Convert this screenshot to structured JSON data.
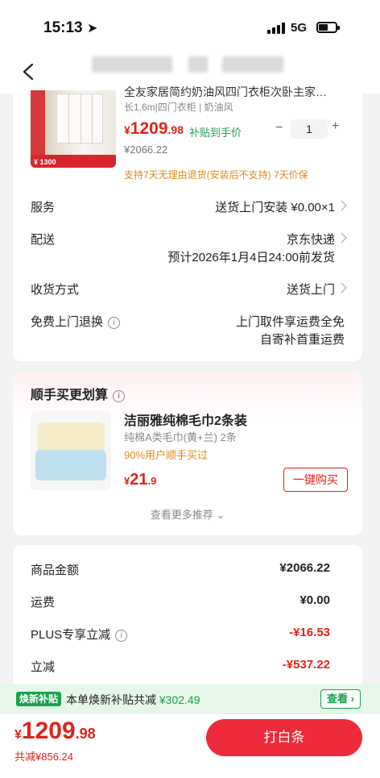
{
  "status_bar": {
    "time": "15:13",
    "network": "5G"
  },
  "product": {
    "title": "全友家居简约奶油风四门衣柜次卧主家…",
    "spec": "长1.6m|四门衣柜 | 奶油风",
    "thumb_price": "¥ 1300",
    "price_currency": "¥",
    "price_int": "1209",
    "price_dec": ".98",
    "subsidy_label": "补贴到手价",
    "quantity": "1",
    "original_price": "¥2066.22",
    "service_note": "支持7天无理由退货(安装后不支持)  7天价保"
  },
  "details": {
    "service_label": "服务",
    "service_value": "送货上门安装 ¥0.00×1",
    "delivery_label": "配送",
    "delivery_value": "京东快递",
    "delivery_eta": "预计2026年1月4日24:00前发货",
    "receive_label": "收货方式",
    "receive_value": "送货上门",
    "return_label": "免费上门退换",
    "return_value_1": "上门取件享运费全免",
    "return_value_2": "自寄补首重运费"
  },
  "recommend": {
    "title": "顺手买更划算",
    "item_name": "洁丽雅纯棉毛巾2条装",
    "item_spec": "纯棉A类毛巾(黄+兰) 2条",
    "item_rate": "90%用户顺手买过",
    "price_currency": "¥",
    "price_int": "21",
    "price_dec": ".9",
    "buy_label": "一键购买",
    "more_label": "查看更多推荐"
  },
  "summary": {
    "goods_label": "商品金额",
    "goods_value": "¥2066.22",
    "shipping_label": "运费",
    "shipping_value": "¥0.00",
    "plus_label": "PLUS专享立减",
    "plus_value": "-¥16.53",
    "discount_label": "立减",
    "discount_value": "-¥537.22"
  },
  "subsidy_bar": {
    "badge": "焕新补贴",
    "text": "本单焕新补贴共减",
    "amount": "¥302.49",
    "view_label": "查看"
  },
  "bottom": {
    "currency": "¥",
    "price_int": "1209",
    "price_dec": ".98",
    "saved": "共减¥856.24",
    "pay_label": "打白条"
  },
  "colors": {
    "accent_red": "#e2231a",
    "subsidy_green": "#16a34a",
    "note_orange": "#e08b1f"
  }
}
